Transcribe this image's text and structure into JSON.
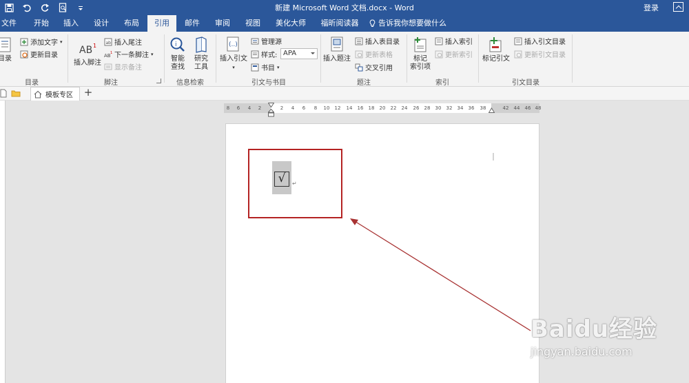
{
  "app": {
    "title": "新建 Microsoft Word 文档.docx - Word",
    "login": "登录"
  },
  "tabs": [
    "文件",
    "开始",
    "插入",
    "设计",
    "布局",
    "引用",
    "邮件",
    "审阅",
    "视图",
    "美化大师",
    "福昕阅读器"
  ],
  "active_tab": "引用",
  "tell_me": "告诉我你想要做什么",
  "ribbon": {
    "toc": {
      "toc_button": "目录",
      "add_text": "添加文字",
      "update_toc": "更新目录",
      "group": "目录"
    },
    "footnotes": {
      "insert_footnote": "插入脚注",
      "insert_endnote": "插入尾注",
      "next_footnote": "下一条脚注",
      "show_notes": "显示备注",
      "group": "脚注"
    },
    "research": {
      "smart_lookup_1": "智能",
      "smart_lookup_2": "查找",
      "researcher_1": "研究",
      "researcher_2": "工具",
      "group": "信息检索"
    },
    "citations": {
      "insert_citation": "插入引文",
      "manage_sources": "管理源",
      "style_label": "样式:",
      "style_value": "APA",
      "bibliography": "书目",
      "group": "引文与书目"
    },
    "captions": {
      "insert_caption": "插入题注",
      "insert_table_of_figures": "插入表目录",
      "update_table": "更新表格",
      "cross_reference": "交叉引用",
      "group": "题注"
    },
    "index": {
      "mark_entry_1": "标记",
      "mark_entry_2": "索引项",
      "insert_index": "插入索引",
      "update_index": "更新索引",
      "group": "索引"
    },
    "toa": {
      "mark_citation": "标记引文",
      "insert_toa": "插入引文目录",
      "update_toa": "更新引文目录",
      "group": "引文目录"
    }
  },
  "doc_tab": "模板专区",
  "ruler_ticks": [
    "8",
    "6",
    "4",
    "2",
    "2",
    "4",
    "6",
    "8",
    "10",
    "12",
    "14",
    "16",
    "18",
    "20",
    "22",
    "24",
    "26",
    "28",
    "30",
    "32",
    "34",
    "36",
    "38",
    "42",
    "44",
    "46",
    "48"
  ],
  "document": {
    "checkbox_symbol": "√",
    "paragraph_mark": "↵"
  },
  "colors": {
    "word_blue": "#2b579a",
    "highlight_box": "#b42222",
    "arrow": "#a83232"
  },
  "watermark": {
    "logo": "Baidu经验",
    "url": "jingyan.baidu.com"
  }
}
